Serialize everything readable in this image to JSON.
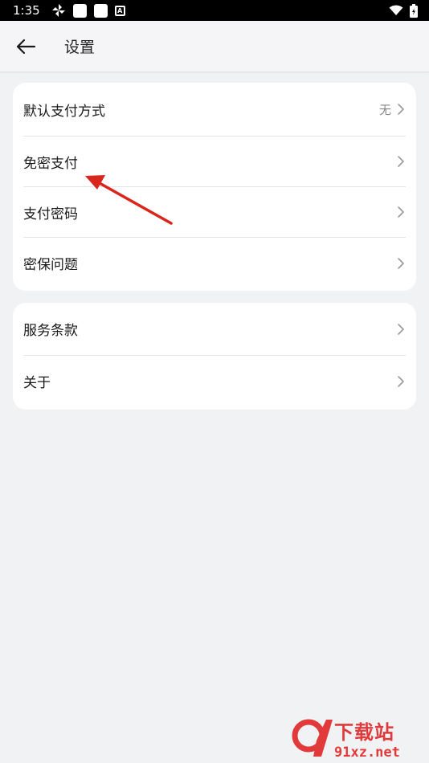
{
  "status_bar": {
    "time": "1:35"
  },
  "header": {
    "title": "设置"
  },
  "group_1": {
    "items": [
      {
        "label": "默认支付方式",
        "value": "无"
      },
      {
        "label": "免密支付",
        "value": ""
      },
      {
        "label": "支付密码",
        "value": ""
      },
      {
        "label": "密保问题",
        "value": ""
      }
    ]
  },
  "group_2": {
    "items": [
      {
        "label": "服务条款",
        "value": ""
      },
      {
        "label": "关于",
        "value": ""
      }
    ]
  },
  "watermark": {
    "brand": "下载站",
    "domain": "91xz.net"
  },
  "colors": {
    "background": "#f1f2f4",
    "card": "#ffffff",
    "annotation_arrow": "#d9261c",
    "watermark": "#e23a3a"
  },
  "icons": {
    "back": "arrow-left-icon",
    "row_chevron": "chevron-right-icon"
  }
}
